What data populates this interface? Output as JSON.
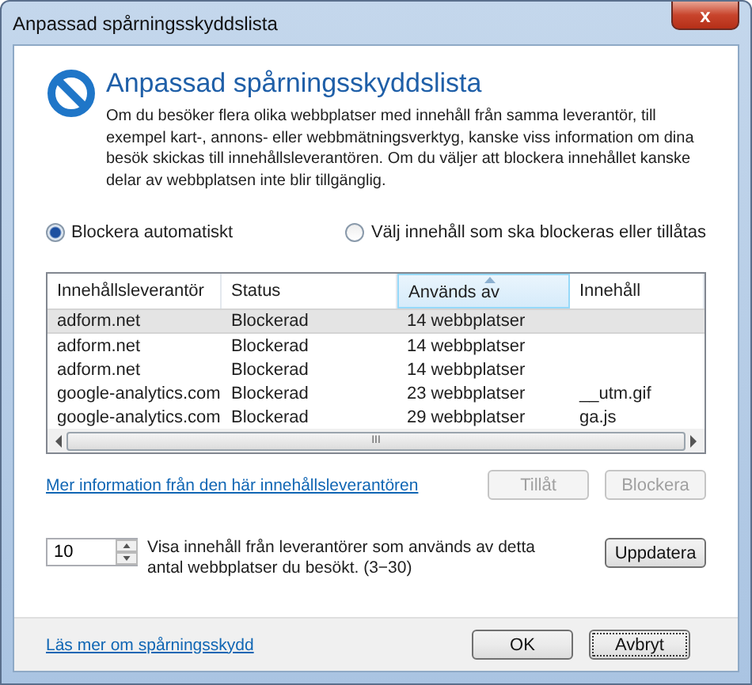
{
  "window": {
    "title": "Anpassad spårningsskyddslista",
    "close_glyph": "x"
  },
  "heading": "Anpassad spårningsskyddslista",
  "description": "Om du besöker flera olika webbplatser med innehåll från samma leverantör, till exempel kart-, annons- eller webbmätningsverktyg, kanske viss information om dina besök skickas till innehållsleverantören. Om du väljer att blockera innehållet kanske delar av webbplatsen inte blir tillgänglig.",
  "modes": [
    {
      "label": "Blockera automatiskt",
      "selected": true
    },
    {
      "label": "Välj innehåll som ska blockeras eller tillåtas",
      "selected": false
    }
  ],
  "table": {
    "columns": [
      {
        "label": "Innehållsleverantör",
        "sorted": false
      },
      {
        "label": "Status",
        "sorted": false
      },
      {
        "label": "Används av",
        "sorted": true
      },
      {
        "label": "Innehåll",
        "sorted": false
      }
    ],
    "rows": [
      {
        "cells": [
          "adform.net",
          "Blockerad",
          "14 webbplatser",
          ""
        ],
        "selected": true
      },
      {
        "cells": [
          "adform.net",
          "Blockerad",
          "14 webbplatser",
          ""
        ],
        "selected": false
      },
      {
        "cells": [
          "adform.net",
          "Blockerad",
          "14 webbplatser",
          ""
        ],
        "selected": false
      },
      {
        "cells": [
          "google-analytics.com",
          "Blockerad",
          "23 webbplatser",
          "__utm.gif"
        ],
        "selected": false
      },
      {
        "cells": [
          "google-analytics.com",
          "Blockerad",
          "29 webbplatser",
          "ga.js"
        ],
        "selected": false
      }
    ],
    "scroll_thumb_glyph": "III"
  },
  "provider_link": "Mer information från den här innehållsleverantören",
  "row_buttons": [
    {
      "label": "Tillåt",
      "disabled": true
    },
    {
      "label": "Blockera",
      "disabled": true
    }
  ],
  "threshold": {
    "value": "10",
    "description": "Visa innehåll från leverantörer som används av detta antal webbplatser du besökt. (3−30)",
    "button": "Uppdatera"
  },
  "footer": {
    "link": "Läs mer om spårningsskydd",
    "buttons": [
      {
        "label": "OK",
        "focused": false
      },
      {
        "label": "Avbryt",
        "focused": true
      }
    ]
  }
}
